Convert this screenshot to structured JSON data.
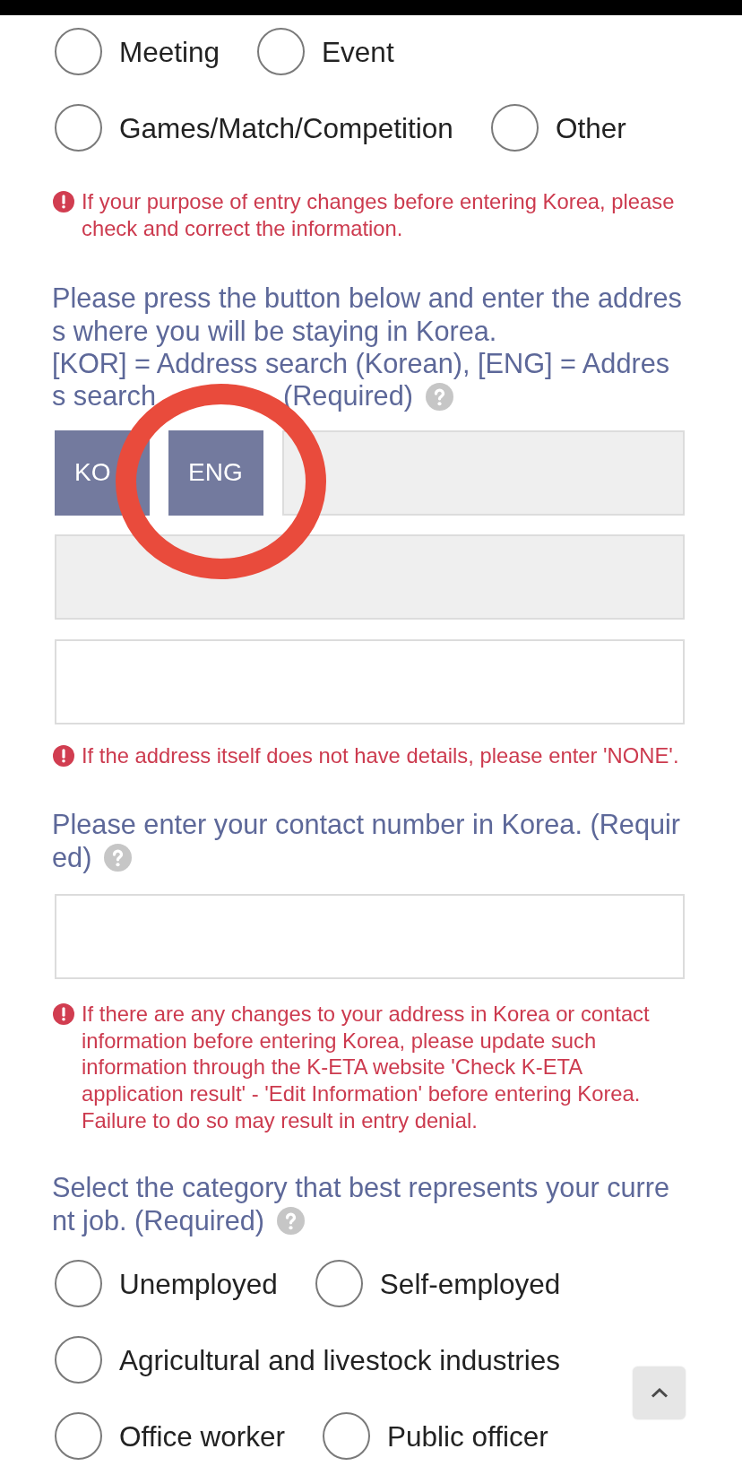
{
  "purpose_options": [
    {
      "label": "Meeting",
      "selected": false
    },
    {
      "label": "Event",
      "selected": false
    },
    {
      "label": "Games/Match/Competition",
      "selected": false
    },
    {
      "label": "Other",
      "selected": false
    }
  ],
  "purpose_notice": "If your purpose of entry changes before entering Korea, please check and correct the information.",
  "address": {
    "question": {
      "lines": [
        "Please press the button below and enter the addres",
        "s where you will be staying in Korea.",
        "[KOR] = Address search (Korean), [ENG] = Addres",
        "s search"
      ],
      "continuation": "(Required)"
    },
    "buttons": [
      {
        "label": "KO",
        "circled": false
      },
      {
        "label": "ENG",
        "circled": true
      }
    ],
    "fields": [
      {
        "disabled": true
      },
      {
        "disabled": true
      },
      {
        "disabled": false
      }
    ],
    "notice": "If the address itself does not have details, please enter 'NONE'."
  },
  "contact": {
    "question": {
      "lines": [
        "Please enter your contact number in Korea. (Requir",
        "ed)"
      ]
    },
    "field": {
      "disabled": false
    },
    "notice": "If there are any changes to your address in Korea or contact information before entering Korea, please update such information through the K-ETA website 'Check K-ETA application result' - 'Edit Information' before entering Korea. Failure to do so may result in entry denial."
  },
  "job": {
    "question": {
      "lines": [
        "Select the category that best represents your curre",
        "nt job. (Required)"
      ]
    },
    "options": [
      {
        "label": "Unemployed",
        "selected": false
      },
      {
        "label": "Self-employed",
        "selected": false
      },
      {
        "label": "Agricultural and livestock industries",
        "selected": false
      },
      {
        "label": "Office worker",
        "selected": false
      },
      {
        "label": "Public officer",
        "selected": false
      }
    ]
  }
}
